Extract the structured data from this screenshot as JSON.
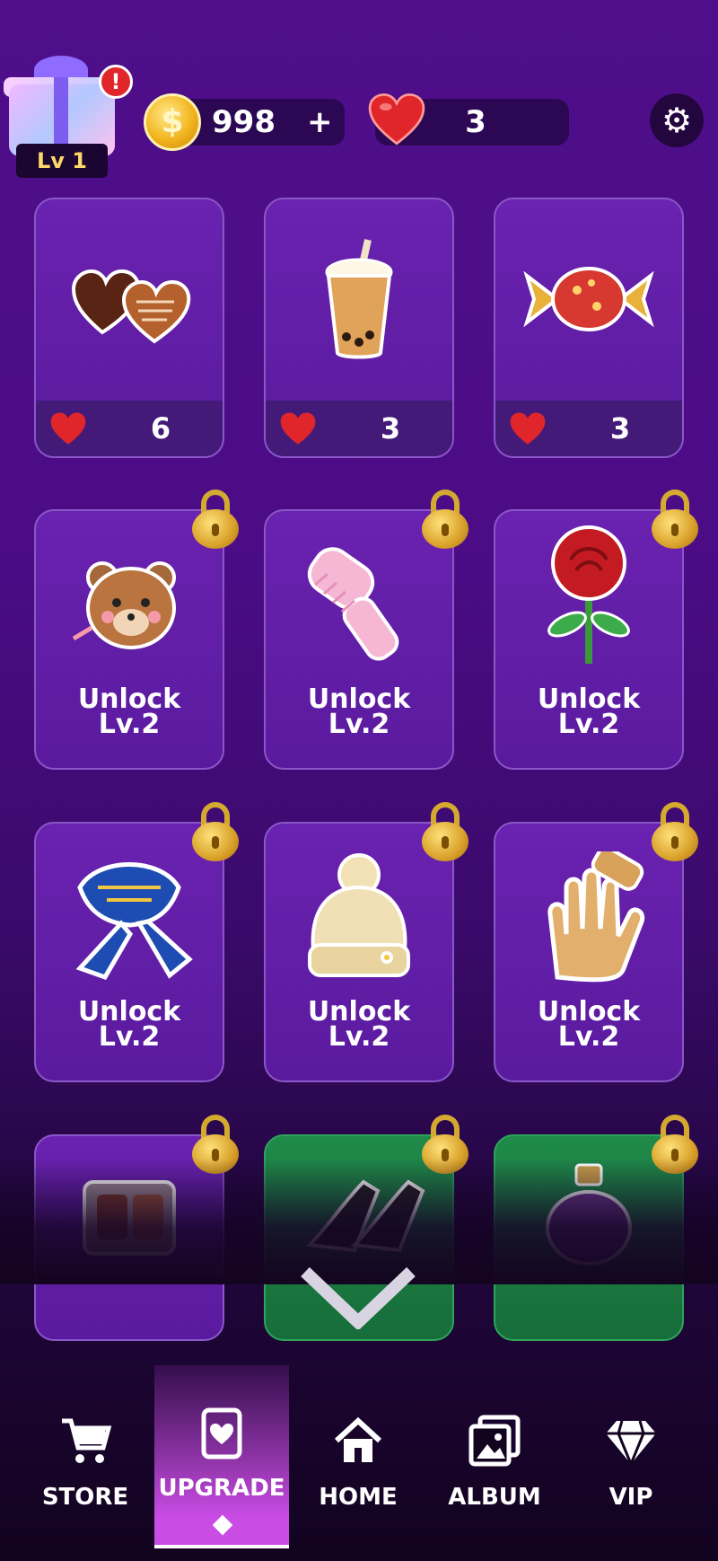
{
  "header": {
    "level_label": "Lv 1",
    "alert_mark": "!",
    "coins": "998",
    "coin_plus": "+",
    "coin_symbol": "$",
    "hearts": "3",
    "settings_icon": "gear-icon"
  },
  "items_row1": [
    {
      "name": "chocolates",
      "price": "6"
    },
    {
      "name": "bubble-tea",
      "price": "3"
    },
    {
      "name": "candy",
      "price": "3"
    }
  ],
  "locked_rows": [
    [
      {
        "name": "teddy-bear-keychain",
        "line1": "Unlock",
        "line2": "Lv.2"
      },
      {
        "name": "pink-comb",
        "line1": "Unlock",
        "line2": "Lv.2"
      },
      {
        "name": "red-rose",
        "line1": "Unlock",
        "line2": "Lv.2"
      }
    ],
    [
      {
        "name": "scarf",
        "line1": "Unlock",
        "line2": "Lv.2"
      },
      {
        "name": "knit-hat",
        "line1": "Unlock",
        "line2": "Lv.2"
      },
      {
        "name": "glove",
        "line1": "Unlock",
        "line2": "Lv.2"
      }
    ]
  ],
  "nav": {
    "store": "STORE",
    "upgrade": "UPGRADE",
    "home": "HOME",
    "album": "ALBUM",
    "vip": "VIP"
  },
  "colors": {
    "accent": "#c94ce5",
    "card": "#5a1a9e",
    "gold": "#d9a12a",
    "heart": "#e0262b"
  }
}
